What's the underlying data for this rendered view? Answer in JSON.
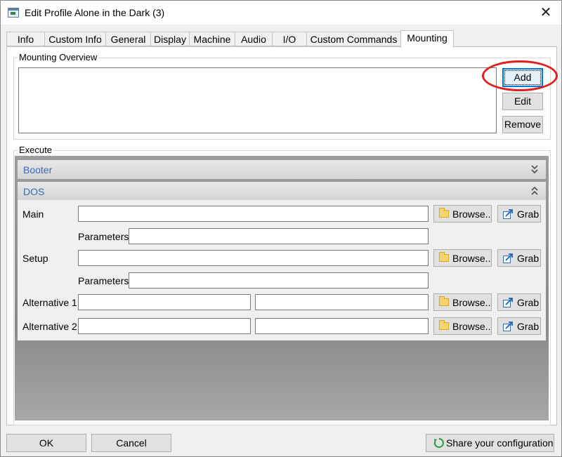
{
  "window": {
    "title": "Edit Profile Alone in the Dark (3)",
    "close_glyph": "✕"
  },
  "tabs": [
    "Info",
    "Custom Info",
    "General",
    "Display",
    "Machine",
    "Audio",
    "I/O",
    "Custom Commands",
    "Mounting"
  ],
  "active_tab": "Mounting",
  "mounting": {
    "group_label": "Mounting Overview",
    "add_label": "Add",
    "edit_label": "Edit",
    "remove_label": "Remove"
  },
  "execute": {
    "group_label": "Execute",
    "booter_label": "Booter",
    "dos_label": "DOS",
    "main_label": "Main",
    "setup_label": "Setup",
    "parameters_label": "Parameters",
    "alt1_label": "Alternative 1",
    "alt2_label": "Alternative 2",
    "browse_label": "Browse..",
    "grab_label": "Grab"
  },
  "footer": {
    "ok_label": "OK",
    "cancel_label": "Cancel",
    "share_label": "Share your configuration"
  },
  "icons": [
    "app-icon",
    "close-icon",
    "chevron-down-double-icon",
    "chevron-up-double-icon",
    "folder-icon",
    "grab-icon",
    "share-icon"
  ],
  "colors": {
    "accent": "#0078d7",
    "highlight_circle": "#e02020",
    "section_label": "#3a6ab6"
  }
}
